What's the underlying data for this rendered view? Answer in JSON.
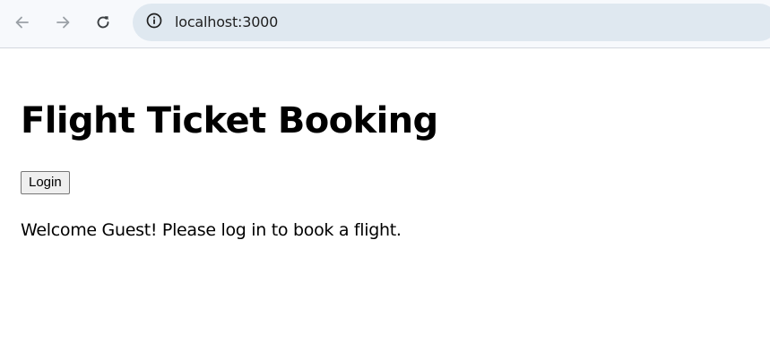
{
  "browser": {
    "url": "localhost:3000",
    "icons": {
      "back": "arrow-left-icon",
      "forward": "arrow-right-icon",
      "reload": "reload-icon",
      "site_info": "info-circle-icon"
    },
    "colors": {
      "toolbar_bg": "#f7f9fc",
      "omnibox_bg": "#dfe8f0"
    }
  },
  "page": {
    "title": "Flight Ticket Booking",
    "login_label": "Login",
    "welcome_message": "Welcome Guest! Please log in to book a flight."
  }
}
